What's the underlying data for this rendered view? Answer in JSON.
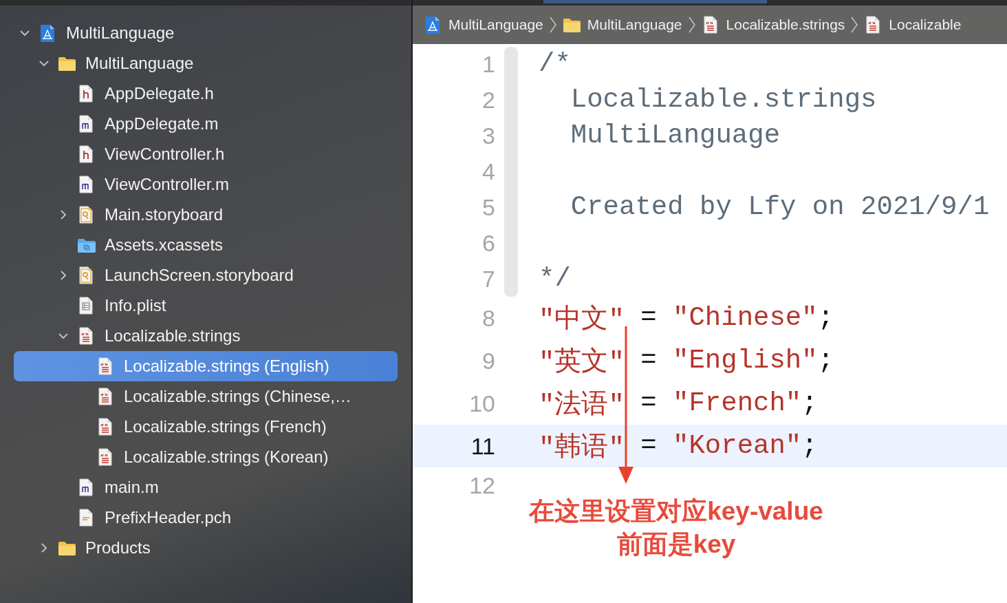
{
  "navigator": {
    "items": [
      {
        "label": "MultiLanguage",
        "kind": "project",
        "expanded": true,
        "selected": false,
        "children": [
          {
            "label": "MultiLanguage",
            "kind": "folder",
            "expanded": true,
            "selected": false,
            "children": [
              {
                "label": "AppDelegate.h",
                "kind": "h",
                "selected": false
              },
              {
                "label": "AppDelegate.m",
                "kind": "m",
                "selected": false
              },
              {
                "label": "ViewController.h",
                "kind": "h",
                "selected": false
              },
              {
                "label": "ViewController.m",
                "kind": "m",
                "selected": false
              },
              {
                "label": "Main.storyboard",
                "kind": "storyboard",
                "expanded": false,
                "selected": false
              },
              {
                "label": "Assets.xcassets",
                "kind": "assets",
                "selected": false
              },
              {
                "label": "LaunchScreen.storyboard",
                "kind": "storyboard",
                "expanded": false,
                "selected": false
              },
              {
                "label": "Info.plist",
                "kind": "plist",
                "selected": false
              },
              {
                "label": "Localizable.strings",
                "kind": "strings",
                "expanded": true,
                "selected": false,
                "children": [
                  {
                    "label": "Localizable.strings (English)",
                    "kind": "strings",
                    "selected": true
                  },
                  {
                    "label": "Localizable.strings (Chinese,…",
                    "kind": "strings",
                    "selected": false
                  },
                  {
                    "label": "Localizable.strings (French)",
                    "kind": "strings",
                    "selected": false
                  },
                  {
                    "label": "Localizable.strings (Korean)",
                    "kind": "strings",
                    "selected": false
                  }
                ]
              },
              {
                "label": "main.m",
                "kind": "m",
                "selected": false
              },
              {
                "label": "PrefixHeader.pch",
                "kind": "pch",
                "selected": false
              }
            ]
          },
          {
            "label": "Products",
            "kind": "folder",
            "expanded": false,
            "selected": false
          }
        ]
      }
    ]
  },
  "jump_bar": {
    "items": [
      {
        "kind": "project",
        "label": "MultiLanguage"
      },
      {
        "kind": "folder",
        "label": "MultiLanguage"
      },
      {
        "kind": "strings",
        "label": "Localizable.strings"
      },
      {
        "kind": "strings",
        "label": "Localizable"
      }
    ]
  },
  "editor": {
    "lines": [
      {
        "number": "1",
        "current": false,
        "tokens": [
          {
            "kind": "comment",
            "text": "/*"
          }
        ]
      },
      {
        "number": "2",
        "current": false,
        "tokens": [
          {
            "kind": "comment",
            "text": "  Localizable.strings"
          }
        ]
      },
      {
        "number": "3",
        "current": false,
        "tokens": [
          {
            "kind": "comment",
            "text": "  MultiLanguage"
          }
        ]
      },
      {
        "number": "4",
        "current": false
      },
      {
        "number": "5",
        "current": false,
        "tokens": [
          {
            "kind": "comment",
            "text": "  Created by Lfy on 2021/9/1"
          }
        ]
      },
      {
        "number": "6",
        "current": false
      },
      {
        "number": "7",
        "current": false,
        "tokens": [
          {
            "kind": "comment",
            "text": "*/"
          }
        ]
      },
      {
        "number": "8",
        "current": false,
        "tokens": [
          {
            "kind": "string",
            "text": "\"中文\""
          },
          {
            "kind": "plain",
            "text": " = "
          },
          {
            "kind": "string",
            "text": "\"Chinese\""
          },
          {
            "kind": "plain",
            "text": ";"
          }
        ]
      },
      {
        "number": "9",
        "current": false,
        "tokens": [
          {
            "kind": "string",
            "text": "\"英文\""
          },
          {
            "kind": "plain",
            "text": " = "
          },
          {
            "kind": "string",
            "text": "\"English\""
          },
          {
            "kind": "plain",
            "text": ";"
          }
        ]
      },
      {
        "number": "10",
        "current": false,
        "tokens": [
          {
            "kind": "string",
            "text": "\"法语\""
          },
          {
            "kind": "plain",
            "text": " = "
          },
          {
            "kind": "string",
            "text": "\"French\""
          },
          {
            "kind": "plain",
            "text": ";"
          }
        ]
      },
      {
        "number": "11",
        "current": true,
        "tokens": [
          {
            "kind": "string",
            "text": "\"韩语\""
          },
          {
            "kind": "plain",
            "text": " = "
          },
          {
            "kind": "string",
            "text": "\"Korean\""
          },
          {
            "kind": "plain",
            "text": ";"
          }
        ]
      },
      {
        "number": "12",
        "current": false
      }
    ]
  },
  "annotation": {
    "lines": [
      "在这里设置对应key-value",
      "前面是key"
    ]
  }
}
